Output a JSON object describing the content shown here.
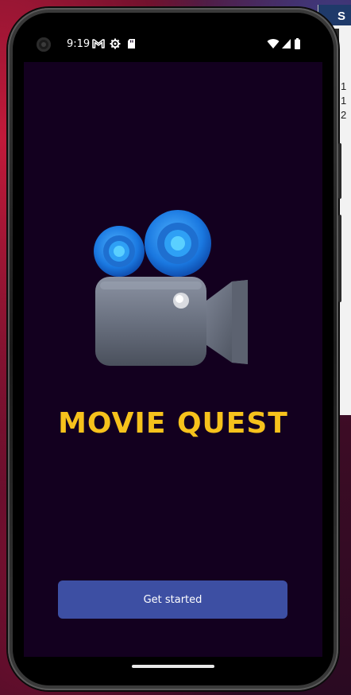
{
  "background_window": {
    "title_letter": "S",
    "rows": [
      "1",
      "1",
      "2"
    ]
  },
  "status_bar": {
    "time": "9:19",
    "icons": [
      "gmail-icon",
      "settings-gear-icon",
      "sd-card-icon",
      "wifi-icon",
      "signal-icon",
      "battery-icon"
    ]
  },
  "app": {
    "title": "MOVIE QUEST",
    "hero_image": "movie-camera-icon",
    "get_started_label": "Get started"
  },
  "colors": {
    "screen_bg": "#13001f",
    "title": "#f6c21c",
    "button_bg": "#3d4fa3",
    "button_text": "#ffffff"
  }
}
